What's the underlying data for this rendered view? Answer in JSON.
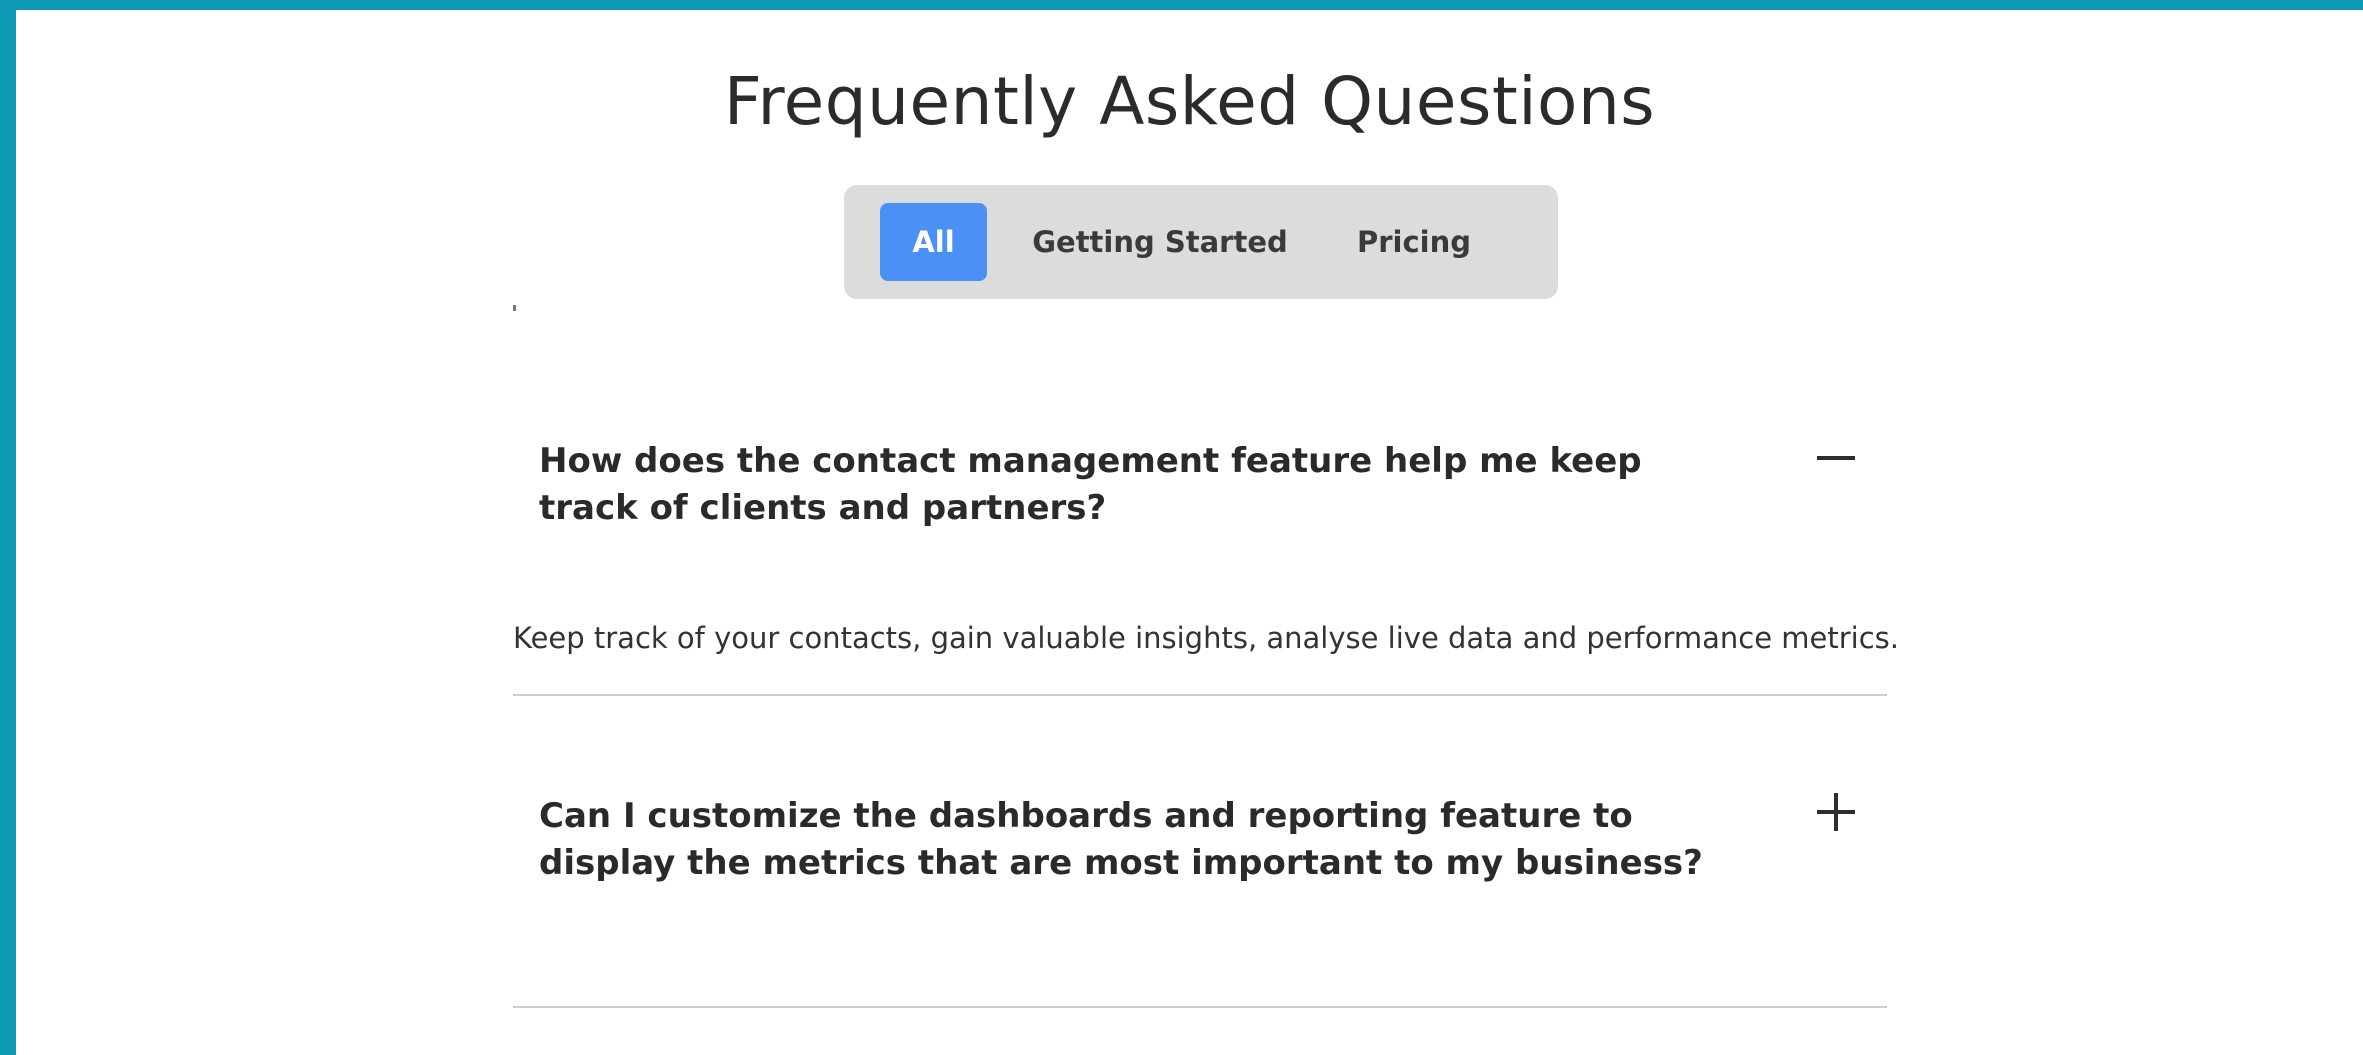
{
  "header": {
    "title": "Frequently Asked Questions"
  },
  "tabs": [
    {
      "label": "All",
      "active": true
    },
    {
      "label": "Getting Started",
      "active": false
    },
    {
      "label": "Pricing",
      "active": false
    }
  ],
  "faqs": [
    {
      "question": "How does the contact management feature help me keep track of clients and partners?",
      "answer": "Keep track of your contacts, gain valuable insights, analyse live data and performance metrics.",
      "expanded": true,
      "toggle_icon": "minus-icon"
    },
    {
      "question": "Can I customize the dashboards and reporting feature to display the metrics that are most important to my business?",
      "answer": "",
      "expanded": false,
      "toggle_icon": "plus-icon"
    }
  ],
  "colors": {
    "frame": "#0e9ab5",
    "accent": "#4a90f5",
    "tab_bar": "#dcdcdc",
    "text": "#2e2e2e"
  }
}
